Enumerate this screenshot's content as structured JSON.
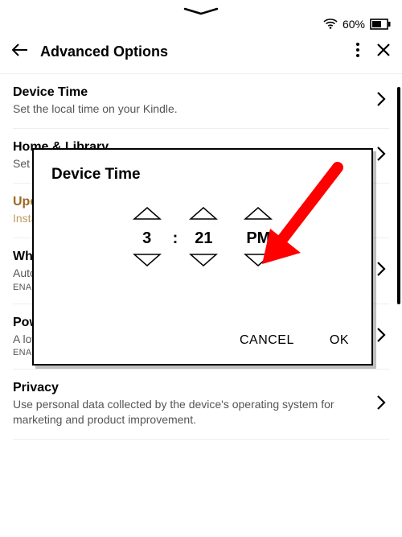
{
  "status": {
    "battery_pct": "60%"
  },
  "header": {
    "title": "Advanced Options"
  },
  "items": [
    {
      "title": "Device Time",
      "sub": "Set the local time on your Kindle.",
      "status": ""
    },
    {
      "title": "Home & Library",
      "sub": "Set display options.",
      "status": ""
    },
    {
      "title": "Update Your Kindle",
      "sub": "Install the latest software.",
      "status": ""
    },
    {
      "title": "Whispersync for Books",
      "sub": "Auto backup and sync annotations and advanced features.",
      "status": "ENABLED"
    },
    {
      "title": "Power Saver",
      "sub": "A low-power sleep mode to conserve battery life.",
      "status": "ENABLED"
    },
    {
      "title": "Privacy",
      "sub": "Use personal data collected by the device's operating system for marketing and product improvement.",
      "status": ""
    }
  ],
  "dialog": {
    "title": "Device Time",
    "hour": "3",
    "minute": "21",
    "ampm": "PM",
    "cancel": "CANCEL",
    "ok": "OK"
  }
}
